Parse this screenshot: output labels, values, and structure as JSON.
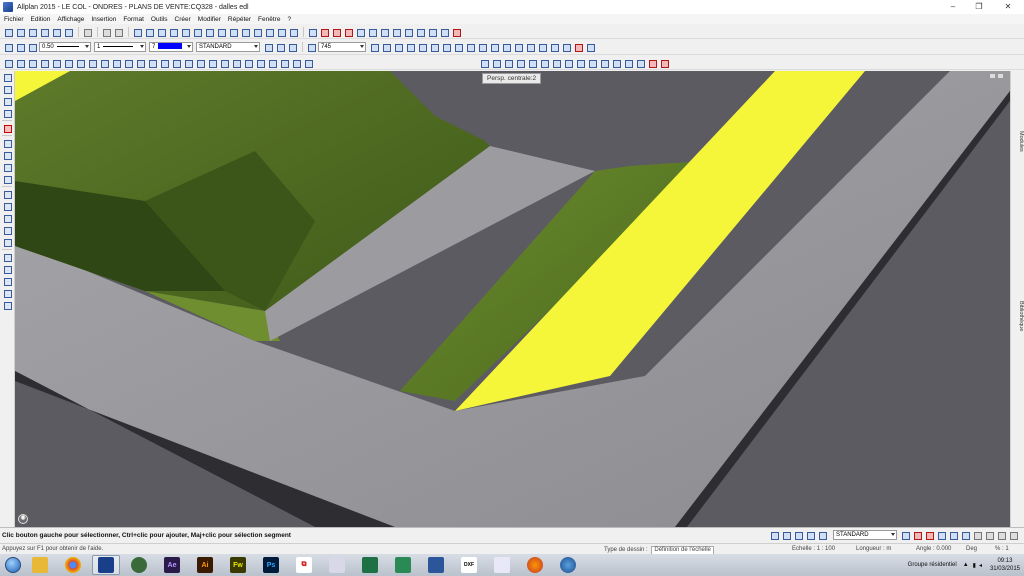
{
  "window": {
    "title": "Allplan 2015 - LE COL - ONDRES - PLANS DE VENTE:CQ328 - dalles edl",
    "minimize": "–",
    "restore": "❐",
    "close": "✕"
  },
  "menu": [
    "Fichier",
    "Edition",
    "Affichage",
    "Insertion",
    "Format",
    "Outils",
    "Créer",
    "Modifier",
    "Répéter",
    "Fenêtre",
    "?"
  ],
  "format_bar": {
    "pen": "0.50",
    "line": "1",
    "color": "7",
    "layer": "STANDARD",
    "pattern": "745"
  },
  "viewport": {
    "view_label": "Persp. centrale:2",
    "navigation_icon": "navigation-wheel-icon"
  },
  "right_tabs": [
    "Modules",
    "Bibliothèque"
  ],
  "status": {
    "message": "Clic bouton gauche pour sélectionner, Ctrl+clic pour ajouter, Maj+clic pour sélection segment",
    "layer": "STANDARD"
  },
  "info_bar": {
    "help": "Appuyez sur F1 pour obtenir de l'aide.",
    "drawing_type_label": "Type de dessin :",
    "drawing_type_value": "Définition de l'échelle",
    "scale_label": "Echelle :",
    "scale_value": "1 : 100",
    "length_label": "Longueur :",
    "length_value": "m",
    "angle_label": "Angle :",
    "angle_value": "0.000",
    "angle_unit": "Deg",
    "percent_label": "% :",
    "percent_value": "1"
  },
  "taskbar": {
    "apps": [
      "Explorer",
      "Chrome",
      "Allplan",
      "Acrobat Reader",
      "Ae",
      "Ai",
      "Fw",
      "Ps",
      "PDF",
      "Calculator",
      "Excel",
      "Excel",
      "Word",
      "DXF",
      "Paint",
      "Firefox",
      "Earth"
    ],
    "tray_text": "Groupe résidentiel",
    "time": "09:13",
    "date": "31/03/2015"
  },
  "colors": {
    "grass": "#4e6a22",
    "pavement": "#9a9a9e",
    "stripe": "#f5f53a",
    "background": "#5a5a60"
  }
}
